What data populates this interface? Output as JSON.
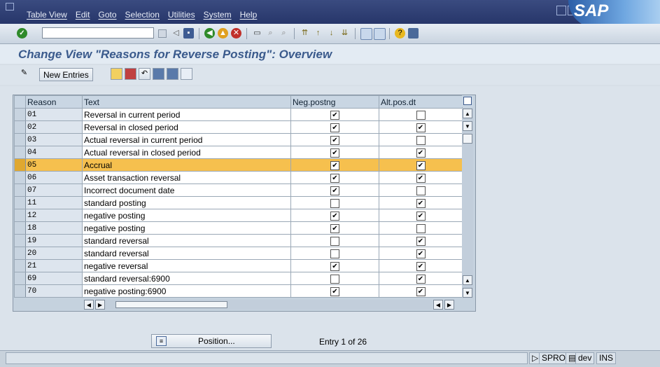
{
  "menu": [
    "Table View",
    "Edit",
    "Goto",
    "Selection",
    "Utilities",
    "System",
    "Help"
  ],
  "brand": "SAP",
  "command_field": {
    "value": ""
  },
  "title": "Change View \"Reasons for Reverse Posting\": Overview",
  "app_toolbar": {
    "new_entries": "New Entries"
  },
  "table": {
    "columns": [
      "Reason",
      "Text",
      "Neg.postng",
      "Alt.pos.dt"
    ],
    "rows": [
      {
        "reason": "01",
        "text": "Reversal in current period",
        "neg": true,
        "alt": false
      },
      {
        "reason": "02",
        "text": "Reversal in closed period",
        "neg": true,
        "alt": true
      },
      {
        "reason": "03",
        "text": "Actual reversal in current period",
        "neg": true,
        "alt": false
      },
      {
        "reason": "04",
        "text": "Actual reversal in closed period",
        "neg": true,
        "alt": true
      },
      {
        "reason": "05",
        "text": "Accrual",
        "neg": true,
        "alt": true,
        "highlighted": true
      },
      {
        "reason": "06",
        "text": "Asset transaction reversal",
        "neg": true,
        "alt": true
      },
      {
        "reason": "07",
        "text": "Incorrect document date",
        "neg": true,
        "alt": false
      },
      {
        "reason": "11",
        "text": "standard posting",
        "neg": false,
        "alt": true
      },
      {
        "reason": "12",
        "text": "negative posting",
        "neg": true,
        "alt": true
      },
      {
        "reason": "18",
        "text": "negative posting",
        "neg": true,
        "alt": false
      },
      {
        "reason": "19",
        "text": "standard reversal",
        "neg": false,
        "alt": true
      },
      {
        "reason": "20",
        "text": "standard reversal",
        "neg": false,
        "alt": true
      },
      {
        "reason": "21",
        "text": "negative reversal",
        "neg": true,
        "alt": true
      },
      {
        "reason": "69",
        "text": "standard reversal:6900",
        "neg": false,
        "alt": true
      },
      {
        "reason": "70",
        "text": "negative posting:6900",
        "neg": true,
        "alt": true
      }
    ]
  },
  "position_button": "Position...",
  "entry_info": "Entry 1 of 26",
  "status": {
    "transaction": "SPRO",
    "system": "dev",
    "mode": "INS"
  },
  "colors": {
    "highlight": "#f6c04e",
    "title": "#3a5a8c",
    "menubar": "#2f3f74"
  }
}
